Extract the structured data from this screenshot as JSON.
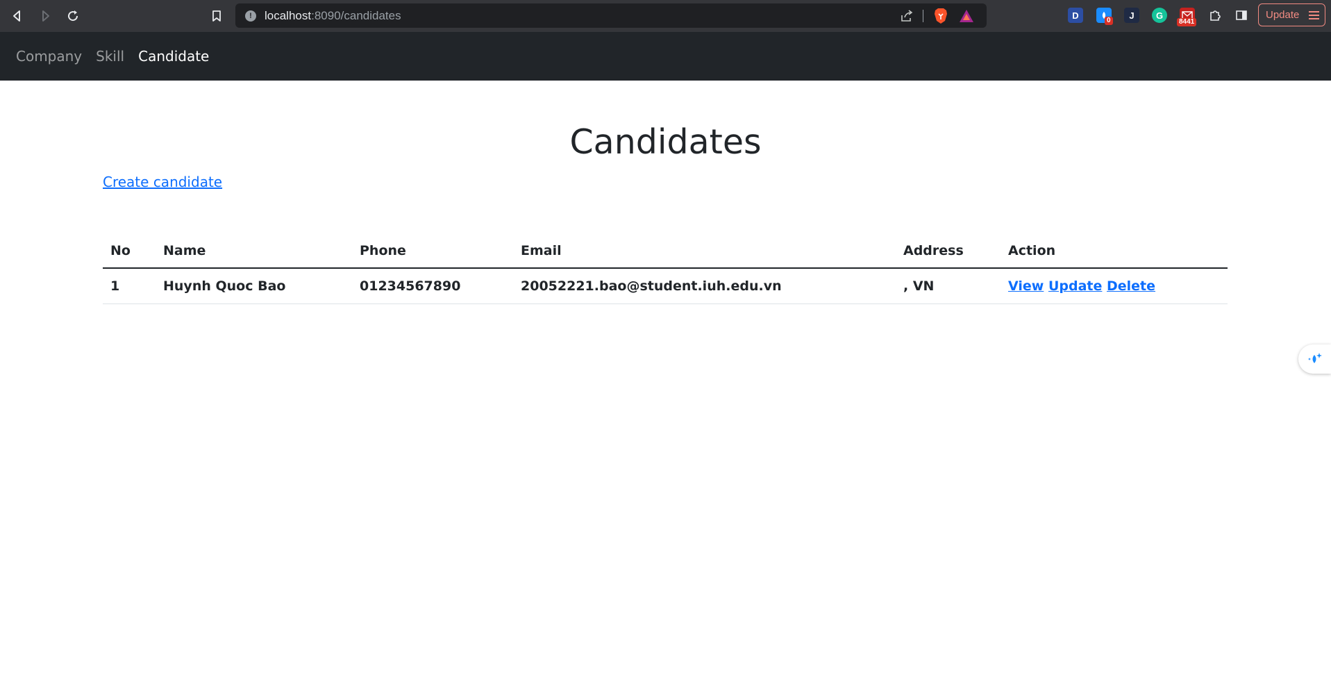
{
  "browser": {
    "url_host": "localhost",
    "url_path": ":8090/candidates",
    "update_label": "Update",
    "extensions": [
      {
        "name": "dashlane",
        "label": "D",
        "color": "#2c4ea3"
      },
      {
        "name": "raindrop",
        "label": "",
        "badge": "0",
        "color": "#1a8cff"
      },
      {
        "name": "jira",
        "label": "J",
        "color": "#0c66e4"
      },
      {
        "name": "grammarly",
        "label": "G",
        "color": "#15c39a"
      },
      {
        "name": "mail",
        "label": "",
        "badge": "8441",
        "color": "#c5221f"
      }
    ]
  },
  "navbar": {
    "items": [
      {
        "label": "Company",
        "active": false
      },
      {
        "label": "Skill",
        "active": false
      },
      {
        "label": "Candidate",
        "active": true
      }
    ]
  },
  "page": {
    "title": "Candidates",
    "create_link": "Create candidate"
  },
  "table": {
    "headers": [
      "No",
      "Name",
      "Phone",
      "Email",
      "Address",
      "Action"
    ],
    "rows": [
      {
        "no": "1",
        "name": "Huynh Quoc Bao",
        "phone": "01234567890",
        "email": "20052221.bao@student.iuh.edu.vn",
        "address": ", VN",
        "actions": [
          "View",
          "Update",
          "Delete"
        ]
      }
    ]
  }
}
